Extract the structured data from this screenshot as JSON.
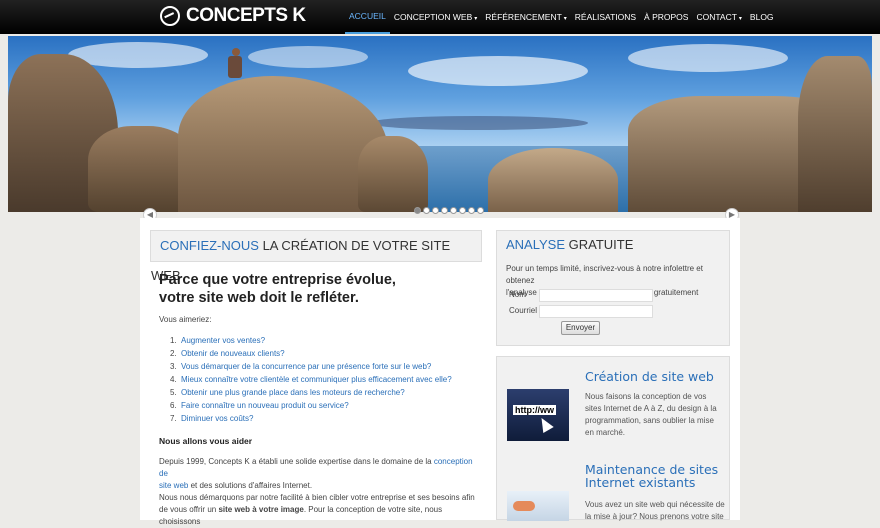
{
  "brand": {
    "name": "CONCEPTS K",
    "logo_icon": "globe-icon"
  },
  "nav": {
    "items": [
      {
        "label": "ACCUEIL",
        "active": true,
        "dropdown": false
      },
      {
        "label": "CONCEPTION WEB",
        "active": false,
        "dropdown": true
      },
      {
        "label": "RÉFÉRENCEMENT",
        "active": false,
        "dropdown": true
      },
      {
        "label": "RÉALISATIONS",
        "active": false,
        "dropdown": false
      },
      {
        "label": "À PROPOS",
        "active": false,
        "dropdown": false
      },
      {
        "label": "CONTACT",
        "active": false,
        "dropdown": true
      },
      {
        "label": "BLOG",
        "active": false,
        "dropdown": false
      }
    ]
  },
  "carousel": {
    "count": 8,
    "current": 1
  },
  "main": {
    "heading_accent": "CONFIEZ-NOUS",
    "heading_rest": " LA CRÉATION DE VOTRE SITE WEB",
    "lead_line1": "Parce que votre entreprise évolue,",
    "lead_line2": "votre site web doit le refléter.",
    "intro": "Vous aimeriez:",
    "list": [
      "Augmenter vos ventes?",
      "Obtenir de nouveaux clients?",
      "Vous démarquer de la concurrence par une présence forte sur le web?",
      "Mieux connaître votre clientèle et communiquer plus efficacement avec elle?",
      "Obtenir une plus grande place dans les moteurs de recherche?",
      "Faire connaître un nouveau produit ou service?",
      "Diminuer vos coûts?"
    ],
    "help_title": "Nous allons vous aider",
    "para1_start": "Depuis 1999, Concepts K a établi une solide expertise dans le domaine de la",
    "para1_link1": "conception de",
    "para1_link2": "site web",
    "para1_end": " et des solutions d'affaires Internet.",
    "para2_line1": "Nous nous démarquons par notre facilité à bien cibler votre entreprise  et ses besoins afin",
    "para2_line2_start": "de vous offrir un ",
    "para2_line2_bold": "site web à votre image",
    "para2_line2_end": ". Pour la conception de votre site, nous choisissons"
  },
  "analysis": {
    "title_accent": "ANALYSE",
    "title_rest": " GRATUITE",
    "text_line1": "Pour un temps limité, inscrivez-vous à notre infolettre et obtenez",
    "text_line2": "l'analyse personnalisée de votre site web gratuitement",
    "name_label": "Nom",
    "email_label": "Courriel",
    "name_value": "",
    "email_value": "",
    "submit_label": "Envoyer"
  },
  "services": [
    {
      "title": "Création de site web",
      "lines": [
        "Nous faisons la conception de vos",
        "sites Internet de A à Z, du design à la",
        "programmation, sans oublier la mise",
        "en marché."
      ],
      "image_icon": "http-url-cursor-icon"
    },
    {
      "title_line1": "Maintenance de sites",
      "title_line2": "Internet existants",
      "lines": [
        "Vous avez un site web qui nécessite de",
        "la mise à jour? Nous prenons votre site"
      ],
      "image_icon": "laptop-hand-icon"
    }
  ],
  "colors": {
    "accent": "#2a6fb8",
    "nav_active": "#6bb7ff",
    "topbar": "#000000"
  }
}
